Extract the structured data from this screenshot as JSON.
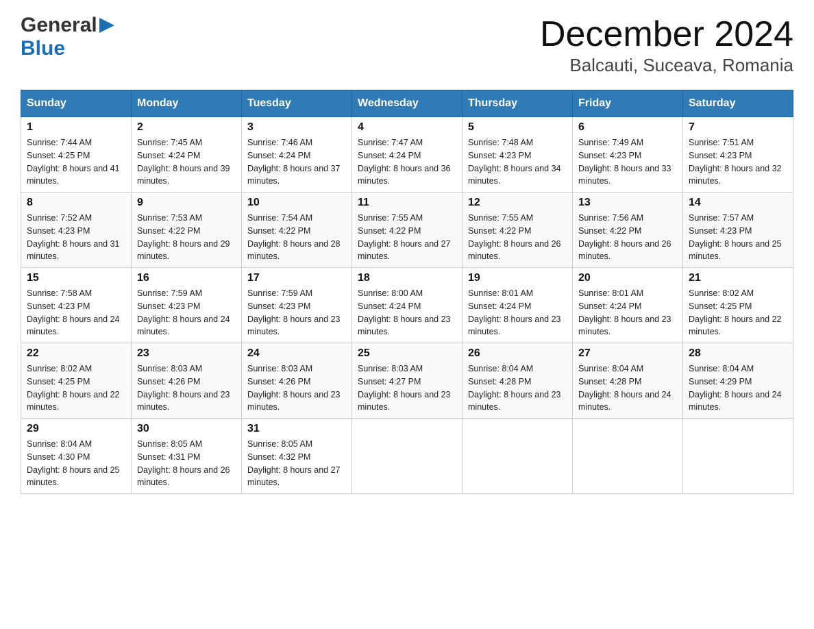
{
  "header": {
    "title": "December 2024",
    "subtitle": "Balcauti, Suceava, Romania"
  },
  "days_of_week": [
    "Sunday",
    "Monday",
    "Tuesday",
    "Wednesday",
    "Thursday",
    "Friday",
    "Saturday"
  ],
  "weeks": [
    [
      {
        "day": "1",
        "sunrise": "7:44 AM",
        "sunset": "4:25 PM",
        "daylight": "8 hours and 41 minutes."
      },
      {
        "day": "2",
        "sunrise": "7:45 AM",
        "sunset": "4:24 PM",
        "daylight": "8 hours and 39 minutes."
      },
      {
        "day": "3",
        "sunrise": "7:46 AM",
        "sunset": "4:24 PM",
        "daylight": "8 hours and 37 minutes."
      },
      {
        "day": "4",
        "sunrise": "7:47 AM",
        "sunset": "4:24 PM",
        "daylight": "8 hours and 36 minutes."
      },
      {
        "day": "5",
        "sunrise": "7:48 AM",
        "sunset": "4:23 PM",
        "daylight": "8 hours and 34 minutes."
      },
      {
        "day": "6",
        "sunrise": "7:49 AM",
        "sunset": "4:23 PM",
        "daylight": "8 hours and 33 minutes."
      },
      {
        "day": "7",
        "sunrise": "7:51 AM",
        "sunset": "4:23 PM",
        "daylight": "8 hours and 32 minutes."
      }
    ],
    [
      {
        "day": "8",
        "sunrise": "7:52 AM",
        "sunset": "4:23 PM",
        "daylight": "8 hours and 31 minutes."
      },
      {
        "day": "9",
        "sunrise": "7:53 AM",
        "sunset": "4:22 PM",
        "daylight": "8 hours and 29 minutes."
      },
      {
        "day": "10",
        "sunrise": "7:54 AM",
        "sunset": "4:22 PM",
        "daylight": "8 hours and 28 minutes."
      },
      {
        "day": "11",
        "sunrise": "7:55 AM",
        "sunset": "4:22 PM",
        "daylight": "8 hours and 27 minutes."
      },
      {
        "day": "12",
        "sunrise": "7:55 AM",
        "sunset": "4:22 PM",
        "daylight": "8 hours and 26 minutes."
      },
      {
        "day": "13",
        "sunrise": "7:56 AM",
        "sunset": "4:22 PM",
        "daylight": "8 hours and 26 minutes."
      },
      {
        "day": "14",
        "sunrise": "7:57 AM",
        "sunset": "4:23 PM",
        "daylight": "8 hours and 25 minutes."
      }
    ],
    [
      {
        "day": "15",
        "sunrise": "7:58 AM",
        "sunset": "4:23 PM",
        "daylight": "8 hours and 24 minutes."
      },
      {
        "day": "16",
        "sunrise": "7:59 AM",
        "sunset": "4:23 PM",
        "daylight": "8 hours and 24 minutes."
      },
      {
        "day": "17",
        "sunrise": "7:59 AM",
        "sunset": "4:23 PM",
        "daylight": "8 hours and 23 minutes."
      },
      {
        "day": "18",
        "sunrise": "8:00 AM",
        "sunset": "4:24 PM",
        "daylight": "8 hours and 23 minutes."
      },
      {
        "day": "19",
        "sunrise": "8:01 AM",
        "sunset": "4:24 PM",
        "daylight": "8 hours and 23 minutes."
      },
      {
        "day": "20",
        "sunrise": "8:01 AM",
        "sunset": "4:24 PM",
        "daylight": "8 hours and 23 minutes."
      },
      {
        "day": "21",
        "sunrise": "8:02 AM",
        "sunset": "4:25 PM",
        "daylight": "8 hours and 22 minutes."
      }
    ],
    [
      {
        "day": "22",
        "sunrise": "8:02 AM",
        "sunset": "4:25 PM",
        "daylight": "8 hours and 22 minutes."
      },
      {
        "day": "23",
        "sunrise": "8:03 AM",
        "sunset": "4:26 PM",
        "daylight": "8 hours and 23 minutes."
      },
      {
        "day": "24",
        "sunrise": "8:03 AM",
        "sunset": "4:26 PM",
        "daylight": "8 hours and 23 minutes."
      },
      {
        "day": "25",
        "sunrise": "8:03 AM",
        "sunset": "4:27 PM",
        "daylight": "8 hours and 23 minutes."
      },
      {
        "day": "26",
        "sunrise": "8:04 AM",
        "sunset": "4:28 PM",
        "daylight": "8 hours and 23 minutes."
      },
      {
        "day": "27",
        "sunrise": "8:04 AM",
        "sunset": "4:28 PM",
        "daylight": "8 hours and 24 minutes."
      },
      {
        "day": "28",
        "sunrise": "8:04 AM",
        "sunset": "4:29 PM",
        "daylight": "8 hours and 24 minutes."
      }
    ],
    [
      {
        "day": "29",
        "sunrise": "8:04 AM",
        "sunset": "4:30 PM",
        "daylight": "8 hours and 25 minutes."
      },
      {
        "day": "30",
        "sunrise": "8:05 AM",
        "sunset": "4:31 PM",
        "daylight": "8 hours and 26 minutes."
      },
      {
        "day": "31",
        "sunrise": "8:05 AM",
        "sunset": "4:32 PM",
        "daylight": "8 hours and 27 minutes."
      },
      null,
      null,
      null,
      null
    ]
  ]
}
